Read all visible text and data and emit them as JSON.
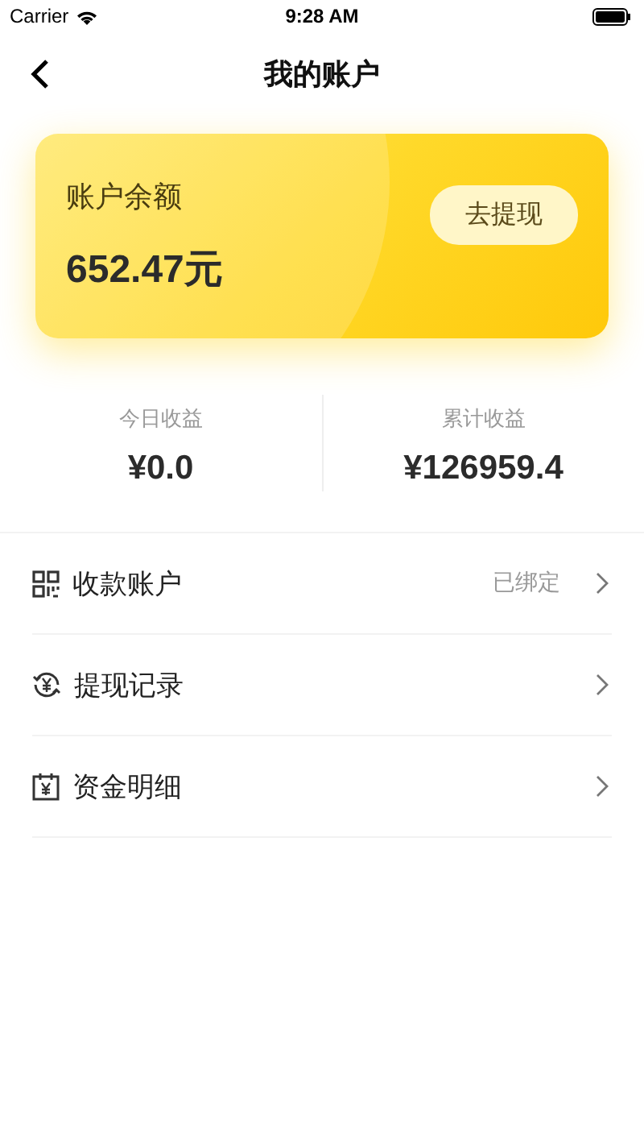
{
  "status_bar": {
    "carrier": "Carrier",
    "time": "9:28 AM"
  },
  "nav": {
    "title": "我的账户"
  },
  "balance_card": {
    "label": "账户余额",
    "amount": "652.47元",
    "button": "去提现"
  },
  "stats": [
    {
      "label": "今日收益",
      "value": "¥0.0"
    },
    {
      "label": "累计收益",
      "value": "¥126959.4"
    }
  ],
  "menu": [
    {
      "kind": "qr",
      "label": "收款账户",
      "status": "已绑定"
    },
    {
      "kind": "withdraw",
      "label": "提现记录"
    },
    {
      "kind": "calendar",
      "label": "资金明细"
    }
  ]
}
